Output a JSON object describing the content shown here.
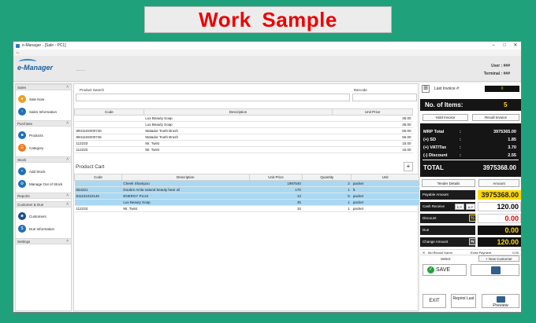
{
  "banner": {
    "text": "Work Sample"
  },
  "window": {
    "title": "e-Manager - [Sale - PC1]"
  },
  "header": {
    "logo": "e-Manager",
    "dots": "....",
    "user_label": "User : ###",
    "terminal_label": "Terminal : ###"
  },
  "sidebar": {
    "sections": [
      {
        "title": "Sales",
        "items": [
          {
            "label": "Sale Now",
            "icon": "sale-icon",
            "color": "#f0a020"
          },
          {
            "label": "Sales Information",
            "icon": "info-icon",
            "color": "#1e6fb8"
          }
        ]
      },
      {
        "title": "Purchase",
        "items": [
          {
            "label": "Products",
            "icon": "products-icon",
            "color": "#1e6fb8"
          },
          {
            "label": "Category",
            "icon": "category-icon",
            "color": "#f07a20"
          }
        ]
      },
      {
        "title": "Stock",
        "items": [
          {
            "label": "Add Stock",
            "icon": "add-stock-icon",
            "color": "#1e6fb8"
          },
          {
            "label": "Manage Out of Stock",
            "icon": "manage-stock-icon",
            "color": "#1e6fb8"
          }
        ]
      },
      {
        "title": "Reports",
        "items": []
      },
      {
        "title": "Customer & Due",
        "items": [
          {
            "label": "Customers",
            "icon": "customers-icon",
            "color": "#1e4f8a"
          },
          {
            "label": "Due Information",
            "icon": "due-icon",
            "color": "#1e6fb8"
          }
        ]
      },
      {
        "title": "Settings",
        "items": []
      }
    ]
  },
  "search": {
    "product_label": "Product Search",
    "barcode_label": "Barcode",
    "product_value": "",
    "barcode_value": ""
  },
  "products": {
    "columns": [
      "Code",
      "Description",
      "Unit Price"
    ],
    "rows": [
      [
        "",
        "Lux Beauty Soap",
        "35.00"
      ],
      [
        "",
        "Lux Beauty Soap",
        "35.00"
      ],
      [
        "8941102000746",
        "Matador Tooth Brush",
        "55.00"
      ],
      [
        "8941102000746",
        "Matador Tooth Brush",
        "55.00"
      ],
      [
        "112233",
        "Mr. Twist",
        "15.00"
      ],
      [
        "112233",
        "Mr. Twist",
        "15.00"
      ]
    ]
  },
  "cart": {
    "title": "Product Cart",
    "add_label": "+",
    "columns": [
      "Code",
      "Description",
      "Unit Price",
      "Quantity",
      "Unit"
    ],
    "rows": [
      [
        "",
        "Cheek Shampoo",
        "1987540",
        "2",
        "packet"
      ],
      [
        "654321",
        "Doubre Amla natural beauty hear oil",
        "170",
        "1",
        "lt."
      ],
      [
        "811101010146",
        "ENERGY PLUS",
        "13",
        "5",
        "packet"
      ],
      [
        "",
        "Lux Beauty Soap",
        "35",
        "1",
        "packet"
      ],
      [
        "112233",
        "Mr. Twist",
        "15",
        "1",
        "packet"
      ]
    ]
  },
  "panel": {
    "last_invoice_label": "Last Invoice #:",
    "last_invoice_value": "0",
    "items_label": "No. of Items:",
    "items_value": "5",
    "hold_label": "Hold Invoice",
    "recall_label": "Recall Invoice",
    "totals": [
      {
        "label": "MRP Total",
        "sep": ":",
        "value": "3975365.00"
      },
      {
        "label": "(+) SD",
        "sep": ":",
        "value": "1.85"
      },
      {
        "label": "(+) VAT/Tax",
        "sep": ":",
        "value": "3.70"
      },
      {
        "label": "(-) Discount",
        "sep": ":",
        "value": "2.55"
      }
    ],
    "total_label": "TOTAL",
    "total_value": "3975368.00",
    "tender_label": "Tender Details",
    "amount_label": "Amount",
    "payable_label": "Payable Amount",
    "payable_value": "3975368.00",
    "cash_label": "Cash Receive",
    "ep_label": "E.P",
    "ap_label": "A.P",
    "cash_value": "120.00",
    "discount_label": "Discount",
    "discount_value": "0.00",
    "due_label": "Due",
    "due_value": "0.00",
    "change_label": "Change Amount",
    "change_value": "120.00",
    "mk_label": "Md Recouf Karim",
    "extra_label": "Extra Payment",
    "extra_value": "0.00",
    "select_label": "Select",
    "new_customer_label": "+ New Customer",
    "save_label": "SAVE",
    "exit_label": "EXIT",
    "reprint_label": "Reprint Last",
    "preview_label": "Preview",
    "colors": {
      "accent_yellow": "#ffd800",
      "red": "#e00000",
      "dark": "#151515",
      "green": "#1fa27c"
    }
  }
}
